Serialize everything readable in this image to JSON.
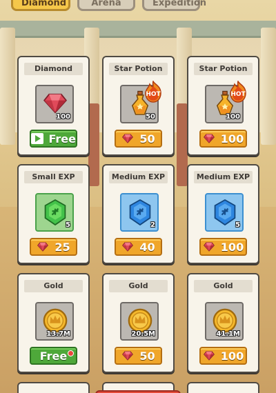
{
  "tabs": [
    {
      "label": "Diamond",
      "active": true
    },
    {
      "label": "Arena",
      "active": false
    },
    {
      "label": "Expedition",
      "active": false
    }
  ],
  "cards": [
    {
      "title": "Diamond",
      "item": "ruby-icon",
      "qty": "100",
      "button": "Free",
      "button_style": "green-ad",
      "hot": false
    },
    {
      "title": "Star Potion",
      "item": "potion-icon",
      "qty": "50",
      "button": "50",
      "button_style": "gold-ruby",
      "hot": true
    },
    {
      "title": "Star Potion",
      "item": "potion-icon",
      "qty": "100",
      "button": "100",
      "button_style": "gold-ruby",
      "hot": true
    },
    {
      "title": "Small EXP",
      "item": "exp-gem-green-icon",
      "qty": "5",
      "button": "25",
      "button_style": "gold-ruby",
      "hot": false
    },
    {
      "title": "Medium EXP",
      "item": "exp-gem-blue-icon",
      "qty": "2",
      "button": "40",
      "button_style": "gold-ruby",
      "hot": false
    },
    {
      "title": "Medium EXP",
      "item": "exp-gem-blue-icon",
      "qty": "5",
      "button": "100",
      "button_style": "gold-ruby",
      "hot": false
    },
    {
      "title": "Gold",
      "item": "gold-coin-icon",
      "qty": "13.7M",
      "button": "Free",
      "button_style": "green-dot",
      "hot": false
    },
    {
      "title": "Gold",
      "item": "gold-coin-icon",
      "qty": "20.5M",
      "button": "50",
      "button_style": "gold-ruby",
      "hot": false
    },
    {
      "title": "Gold",
      "item": "gold-coin-icon",
      "qty": "41.1M",
      "button": "100",
      "button_style": "gold-ruby",
      "hot": false
    }
  ],
  "hot_badge": "HOT",
  "colors": {
    "gold_button": "#f0a62a",
    "green_button": "#4ea83a",
    "active_tab": "#f5c74a",
    "ruby": "#e04a5a"
  }
}
